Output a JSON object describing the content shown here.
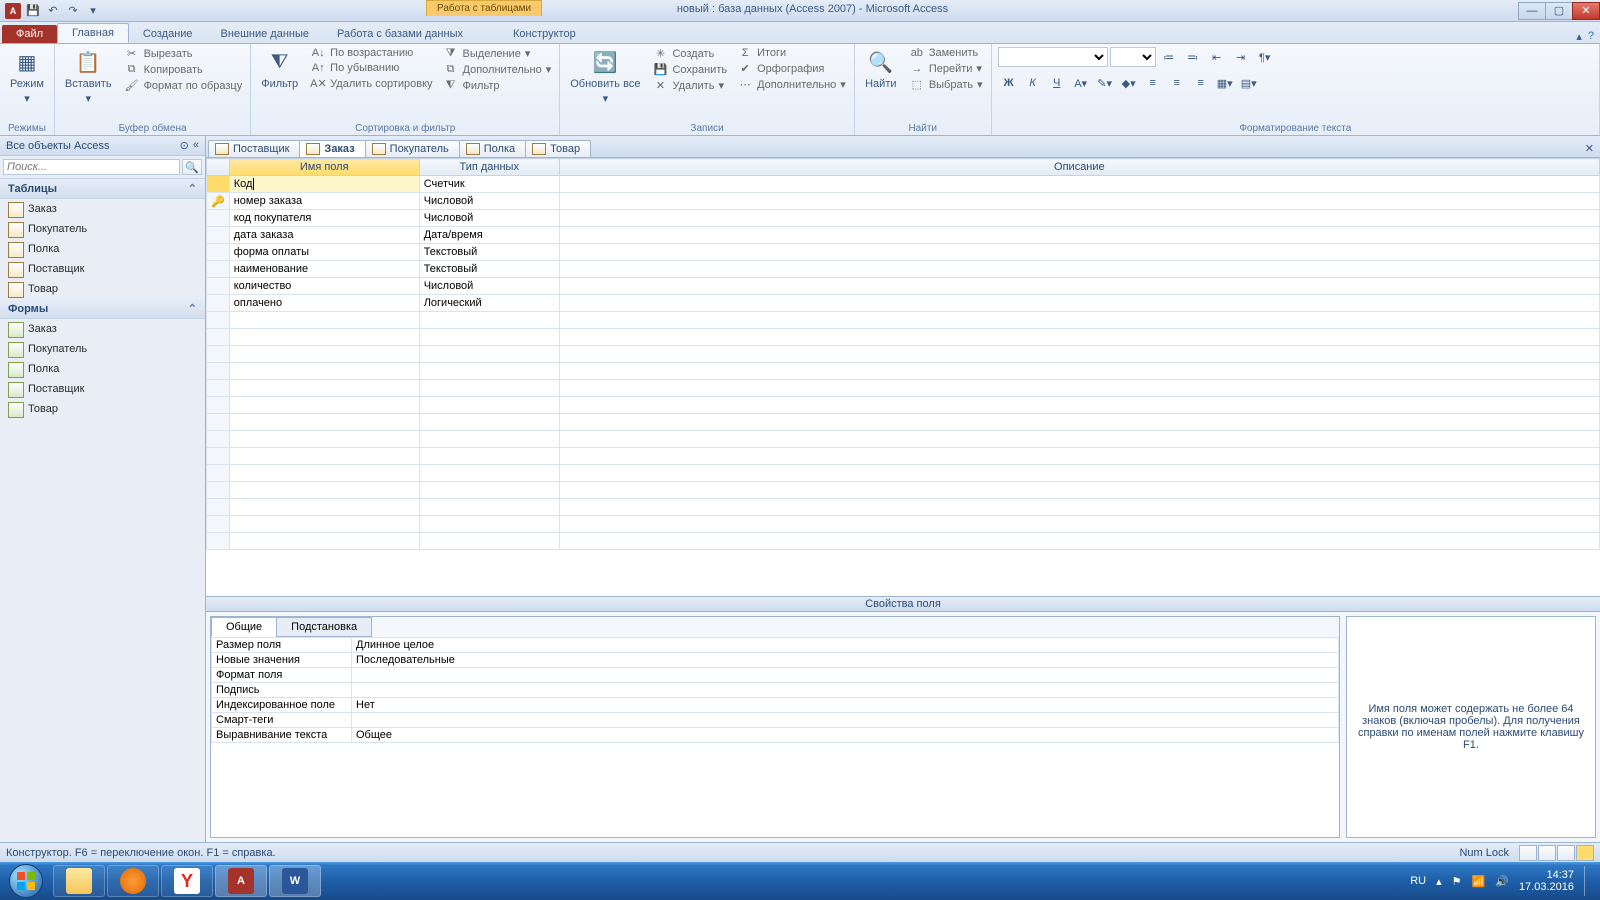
{
  "titlebar": {
    "context_tab_header": "Работа с таблицами",
    "doc_title": "новый : база данных (Access 2007)  -  Microsoft Access"
  },
  "ribbon_tabs": {
    "file": "Файл",
    "home": "Главная",
    "create": "Создание",
    "external": "Внешние данные",
    "dbtools": "Работа с базами данных",
    "design": "Конструктор"
  },
  "ribbon": {
    "views": {
      "label": "Режимы",
      "view_btn": "Режим"
    },
    "clipboard": {
      "label": "Буфер обмена",
      "paste": "Вставить",
      "cut": "Вырезать",
      "copy": "Копировать",
      "format": "Формат по образцу"
    },
    "sortfilter": {
      "label": "Сортировка и фильтр",
      "filter": "Фильтр",
      "asc": "По возрастанию",
      "desc": "По убыванию",
      "clear": "Удалить сортировку",
      "selection": "Выделение",
      "advanced": "Дополнительно",
      "toggle": "Фильтр"
    },
    "records": {
      "label": "Записи",
      "refresh": "Обновить все",
      "new": "Создать",
      "save": "Сохранить",
      "delete": "Удалить",
      "totals": "Итоги",
      "spelling": "Орфография",
      "more": "Дополнительно"
    },
    "find": {
      "label": "Найти",
      "find": "Найти",
      "replace": "Заменить",
      "goto": "Перейти",
      "select": "Выбрать"
    },
    "textfmt": {
      "label": "Форматирование текста"
    }
  },
  "navpane": {
    "header": "Все объекты Access",
    "search_placeholder": "Поиск...",
    "group_tables": "Таблицы",
    "group_forms": "Формы",
    "tables": [
      "Заказ",
      "Покупатель",
      "Полка",
      "Поставщик",
      "Товар"
    ],
    "forms": [
      "Заказ",
      "Покупатель",
      "Полка",
      "Поставщик",
      "Товар"
    ]
  },
  "doctabs": [
    "Поставщик",
    "Заказ",
    "Покупатель",
    "Полка",
    "Товар"
  ],
  "doctab_active_index": 1,
  "design": {
    "col_name": "Имя поля",
    "col_type": "Тип данных",
    "col_desc": "Описание",
    "rows": [
      {
        "name": "Код",
        "type": "Счетчик",
        "key": false,
        "active": true
      },
      {
        "name": "номер заказа",
        "type": "Числовой",
        "key": true
      },
      {
        "name": "код покупателя",
        "type": "Числовой",
        "key": false
      },
      {
        "name": "дата заказа",
        "type": "Дата/время",
        "key": false
      },
      {
        "name": "форма оплаты",
        "type": "Текстовый",
        "key": false
      },
      {
        "name": "наименование",
        "type": "Текстовый",
        "key": false
      },
      {
        "name": "количество",
        "type": "Числовой",
        "key": false
      },
      {
        "name": "оплачено",
        "type": "Логический",
        "key": false
      }
    ]
  },
  "fieldprops": {
    "bar": "Свойства поля",
    "tab_general": "Общие",
    "tab_lookup": "Подстановка",
    "rows": [
      {
        "n": "Размер поля",
        "v": "Длинное целое"
      },
      {
        "n": "Новые значения",
        "v": "Последовательные"
      },
      {
        "n": "Формат поля",
        "v": ""
      },
      {
        "n": "Подпись",
        "v": ""
      },
      {
        "n": "Индексированное поле",
        "v": "Нет"
      },
      {
        "n": "Смарт-теги",
        "v": ""
      },
      {
        "n": "Выравнивание текста",
        "v": "Общее"
      }
    ],
    "help": "Имя поля может содержать не более 64 знаков (включая пробелы). Для получения справки по именам полей нажмите клавишу F1."
  },
  "statusbar": {
    "left": "Конструктор.   F6 = переключение окон.   F1 = справка.",
    "numlock": "Num Lock"
  },
  "taskbar": {
    "lang": "RU",
    "time": "14:37",
    "date": "17.03.2016"
  }
}
